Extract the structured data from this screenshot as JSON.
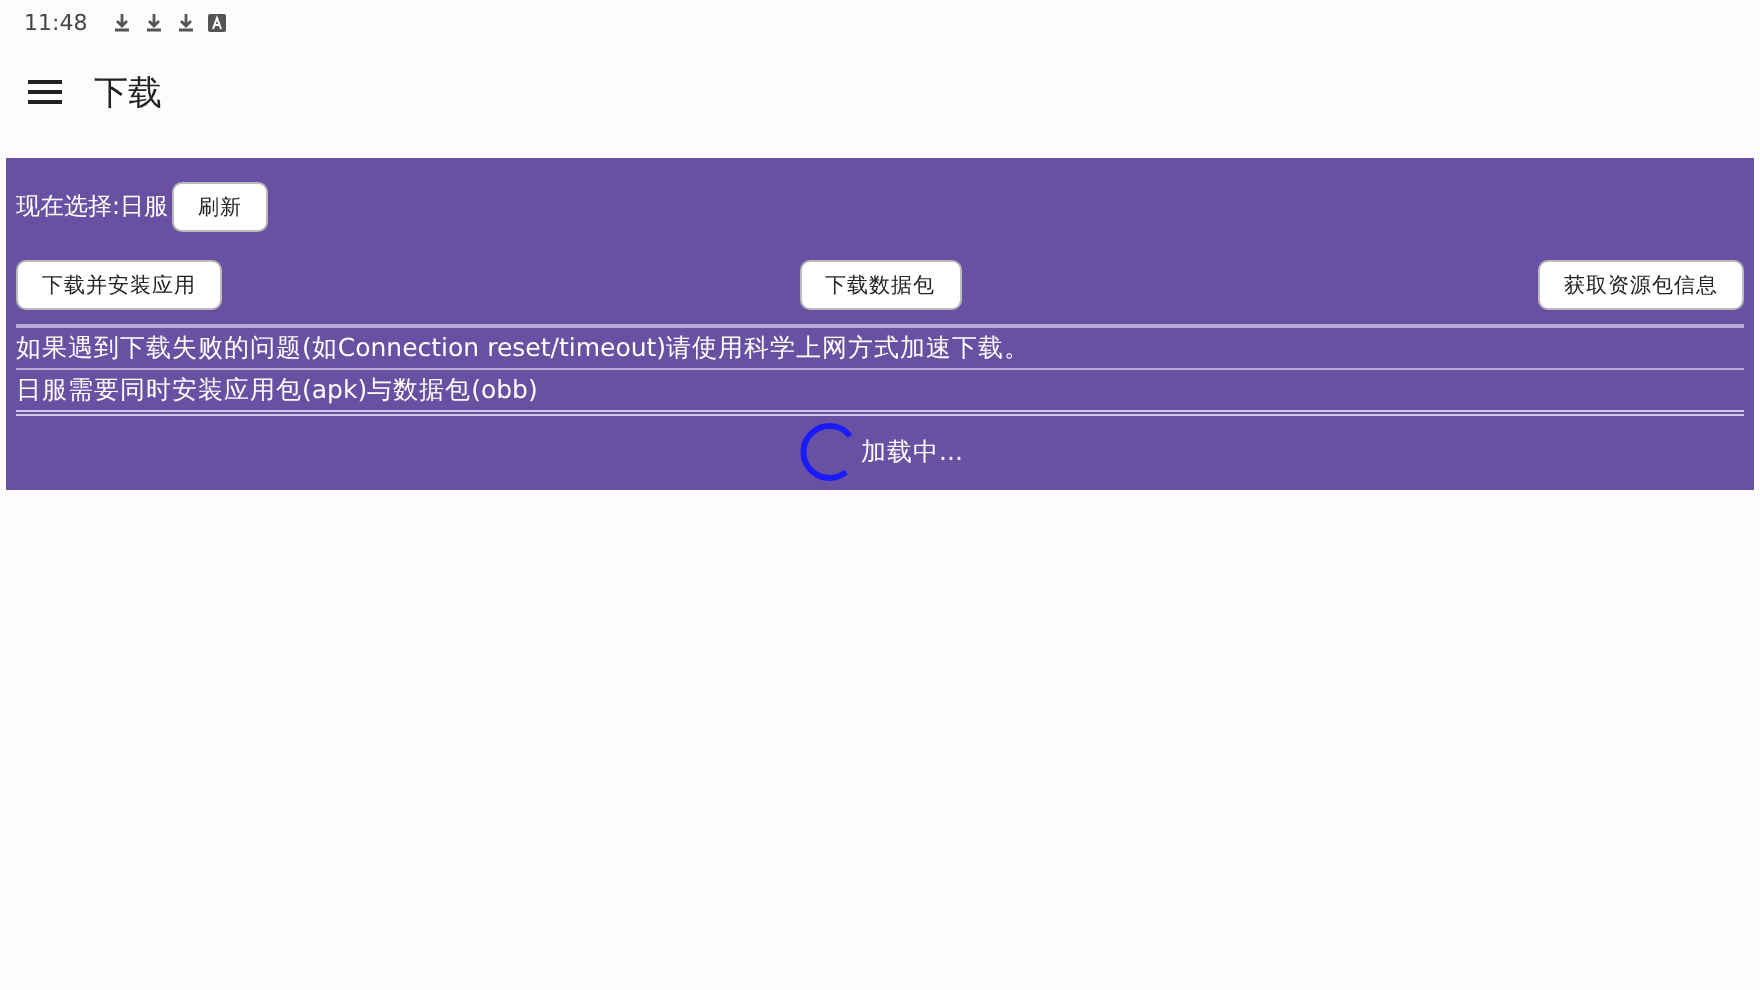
{
  "status_bar": {
    "time": "11:48"
  },
  "app_bar": {
    "title": "下载"
  },
  "panel": {
    "selection_label": "现在选择:日服",
    "refresh_button": "刷新",
    "action_buttons": [
      "下载并安装应用",
      "下载数据包",
      "获取资源包信息"
    ],
    "notes": [
      "如果遇到下载失败的问题(如Connection reset/timeout)请使用科学上网方式加速下载。",
      "日服需要同时安装应用包(apk)与数据包(obb)"
    ],
    "loading_text": "加载中..."
  }
}
